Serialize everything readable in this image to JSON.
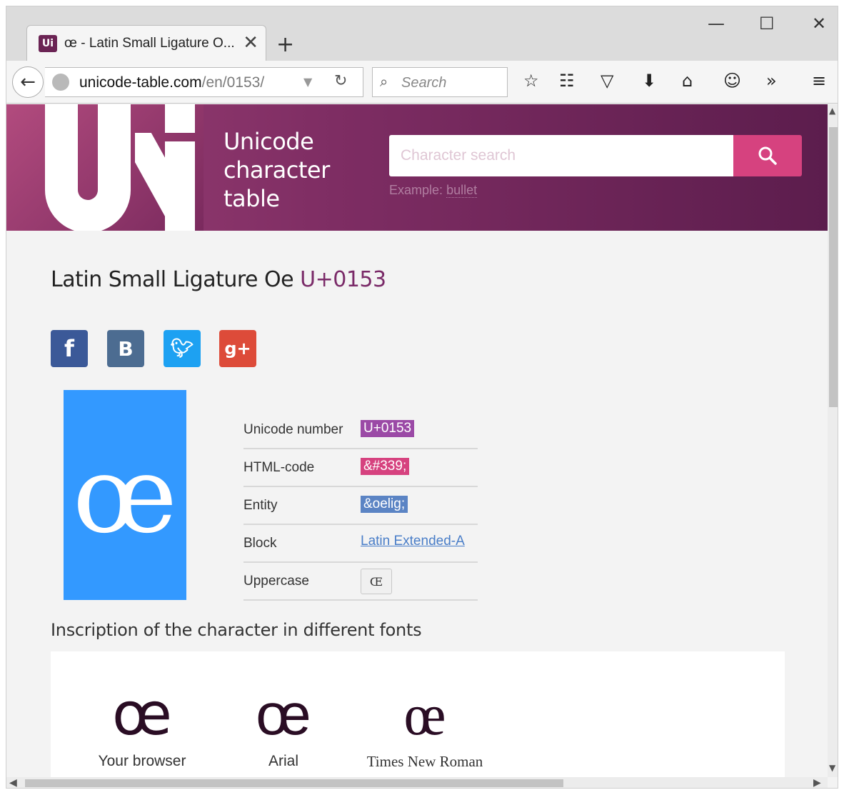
{
  "browser": {
    "tab": {
      "favicon_text": "Ui",
      "title": "œ - Latin Small Ligature O...",
      "close_glyph": "✕"
    },
    "new_tab_glyph": "+",
    "window_controls": {
      "minimize": "—",
      "maximize": "☐",
      "close": "✕"
    },
    "url": {
      "host": "unicode-table.com",
      "path": "/en/0153/"
    },
    "search_placeholder": "Search",
    "toolbar_icons": [
      "star-icon",
      "reading-list-icon",
      "pocket-icon",
      "download-icon",
      "home-icon",
      "chat-icon",
      "overflow-icon",
      "menu-icon"
    ]
  },
  "site": {
    "brand_lines": [
      "Unicode",
      "character",
      "table"
    ],
    "search_placeholder": "Character search",
    "example_prefix": "Example:",
    "example_link": "bullet",
    "colors": {
      "header": "#7e2d63",
      "accent": "#d6427f",
      "preview_bg": "#3399ff"
    }
  },
  "character": {
    "name": "Latin Small Ligature Oe",
    "code": "U+0153",
    "glyph": "œ",
    "social": [
      "facebook-icon",
      "vk-icon",
      "twitter-icon",
      "google-plus-icon"
    ],
    "properties": [
      {
        "label": "Unicode number",
        "value": "U+0153"
      },
      {
        "label": "HTML-code",
        "value": "&#339;"
      },
      {
        "label": "Entity",
        "value": "&oelig;"
      },
      {
        "label": "Block",
        "value": "Latin Extended-A"
      },
      {
        "label": "Uppercase",
        "value": "Œ"
      }
    ]
  },
  "fonts_section": {
    "heading": "Inscription of the character in different fonts",
    "samples": [
      {
        "glyph": "œ",
        "name": "Your browser"
      },
      {
        "glyph": "œ",
        "name": "Arial"
      },
      {
        "glyph": "œ",
        "name": "Times New Roman"
      }
    ]
  }
}
